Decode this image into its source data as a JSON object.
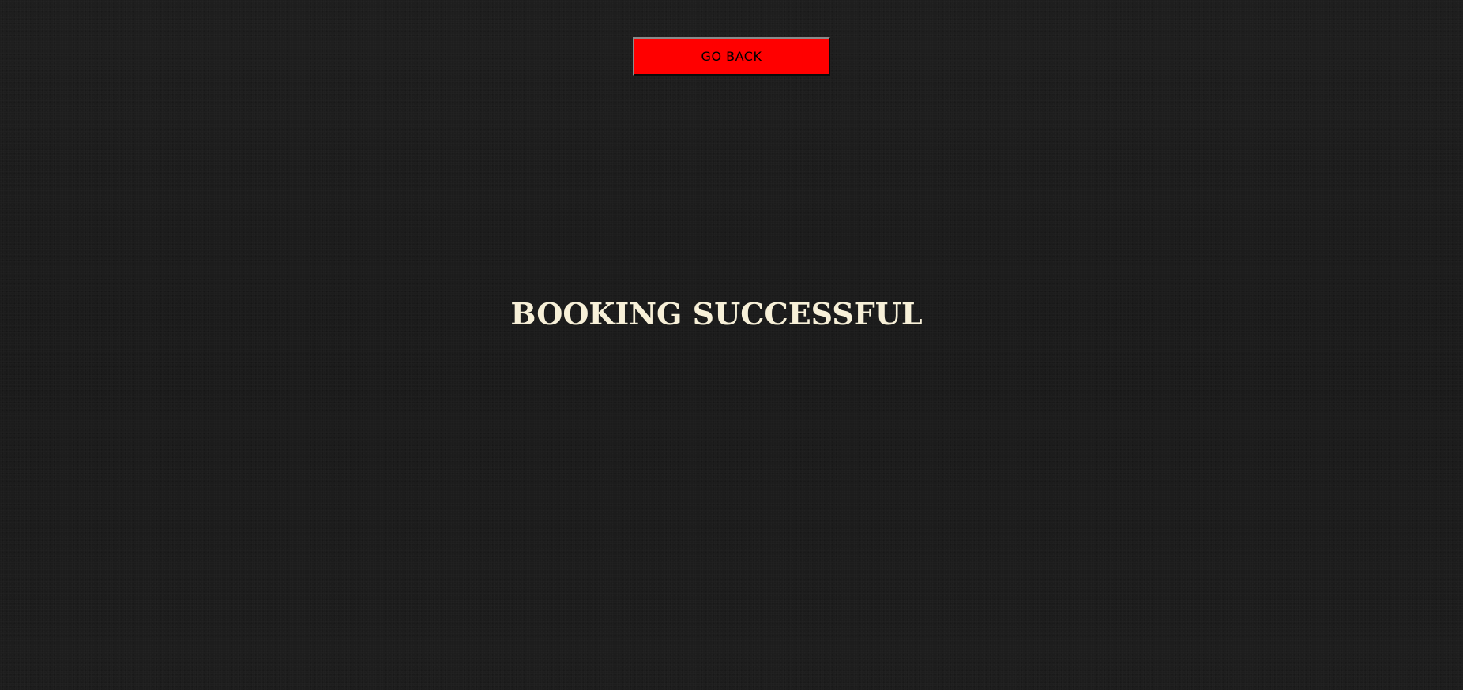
{
  "header": {
    "go_back_label": "GO BACK"
  },
  "main": {
    "title": "BOOKING SUCCESSFUL"
  },
  "colors": {
    "background": "#1c1c1c",
    "button_background": "#ff0000",
    "button_text": "#000000",
    "title_text": "#f7f0d8"
  }
}
